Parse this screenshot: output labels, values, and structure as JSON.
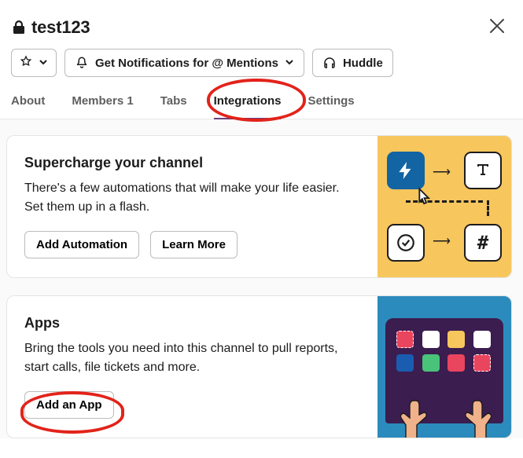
{
  "header": {
    "title": "test123"
  },
  "toolbar": {
    "notifications_label": "Get Notifications for @ Mentions",
    "huddle_label": "Huddle"
  },
  "tabs": [
    {
      "id": "about",
      "label": "About",
      "active": false
    },
    {
      "id": "members",
      "label": "Members 1",
      "active": false
    },
    {
      "id": "tabs",
      "label": "Tabs",
      "active": false
    },
    {
      "id": "integrations",
      "label": "Integrations",
      "active": true
    },
    {
      "id": "settings",
      "label": "Settings",
      "active": false
    }
  ],
  "cards": {
    "automations": {
      "title": "Supercharge your channel",
      "body": "There's a few automations that will make your life easier. Set them up in a flash.",
      "add_label": "Add Automation",
      "learn_label": "Learn More"
    },
    "apps": {
      "title": "Apps",
      "body": "Bring the tools you need into this channel to pull reports, start calls, file tickets and more.",
      "add_label": "Add an App"
    }
  },
  "annotations": {
    "tab_highlight": "integrations",
    "button_highlight": "add-an-app"
  }
}
